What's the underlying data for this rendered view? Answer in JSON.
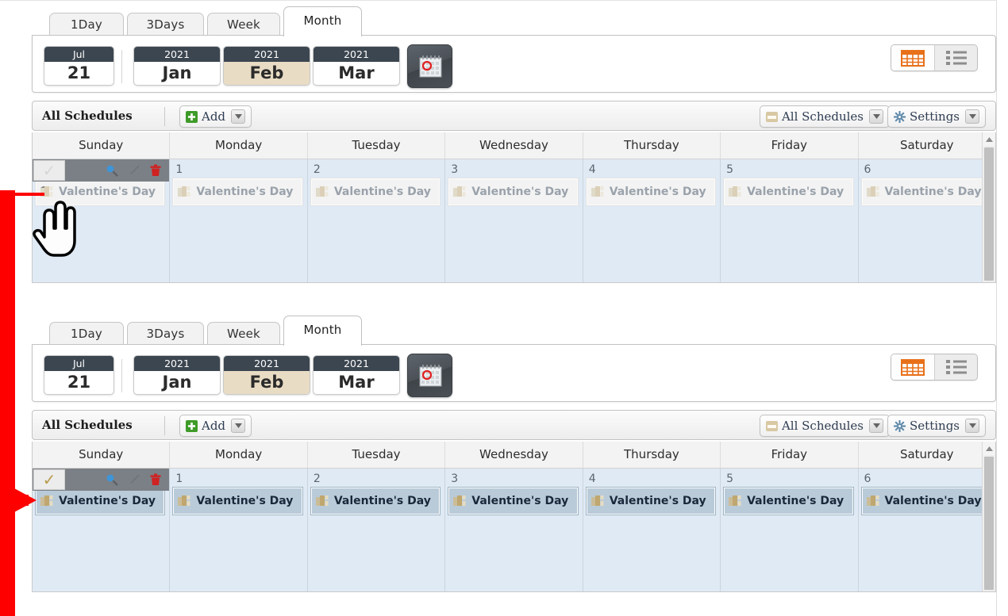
{
  "panels": [
    {
      "id": "top",
      "state": "faded"
    },
    {
      "id": "bottom",
      "state": "normal"
    }
  ],
  "tabs": [
    {
      "label": "1Day",
      "active": false
    },
    {
      "label": "3Days",
      "active": false
    },
    {
      "label": "Week",
      "active": false
    },
    {
      "label": "Month",
      "active": true
    }
  ],
  "datebar": {
    "day_button": {
      "top": "Jul",
      "bottom": "21",
      "selected": false
    },
    "month_buttons": [
      {
        "top": "2021",
        "bottom": "Jan",
        "selected": false
      },
      {
        "top": "2021",
        "bottom": "Feb",
        "selected": true
      },
      {
        "top": "2021",
        "bottom": "Mar",
        "selected": false
      }
    ],
    "date_picker_icon": "calendar-picker-icon"
  },
  "view_toggle": {
    "calendar_view_icon": "calendar-grid-icon",
    "list_view_icon": "list-view-icon",
    "active": "calendar"
  },
  "toolbar": {
    "title": "All Schedules",
    "add_label": "Add",
    "add_icon": "plus-icon",
    "filter_label": "All Schedules",
    "filter_icon": "schedule-folder-icon",
    "settings_label": "Settings",
    "settings_icon": "gear-icon",
    "caret_icon": "chevron-down-icon"
  },
  "calendar": {
    "weekdays": [
      "Sunday",
      "Monday",
      "Tuesday",
      "Wednesday",
      "Thursday",
      "Friday",
      "Saturday"
    ],
    "days": [
      {
        "number": "",
        "event": "Valentine's Day",
        "selected": true
      },
      {
        "number": "1",
        "event": "Valentine's Day",
        "selected": false
      },
      {
        "number": "2",
        "event": "Valentine's Day",
        "selected": false
      },
      {
        "number": "3",
        "event": "Valentine's Day",
        "selected": false
      },
      {
        "number": "4",
        "event": "Valentine's Day",
        "selected": false
      },
      {
        "number": "5",
        "event": "Valentine's Day",
        "selected": false
      },
      {
        "number": "6",
        "event": "Valentine's Day",
        "selected": false
      }
    ],
    "hover_actions": {
      "check_icon": "checkmark-icon",
      "check_glyph": "✓",
      "preview_icon": "magnifier-icon",
      "edit_icon": "pencil-icon",
      "delete_icon": "trash-icon"
    },
    "event_icon": "blocks-icon"
  },
  "scrollbar": {
    "up_arrow_icon": "scroll-up-arrow-icon"
  },
  "annotation": {
    "color": "#fe0000",
    "pointer_icon": "hand-pointer-cursor"
  },
  "colors": {
    "accent_orange": "#e8701a",
    "day_cell_blue": "#dfeaf5",
    "chip_blue": "#b9cbd9",
    "header_dark": "#3c4650",
    "selected_tan": "#e8dcc4",
    "annotation_red": "#fe0000"
  }
}
